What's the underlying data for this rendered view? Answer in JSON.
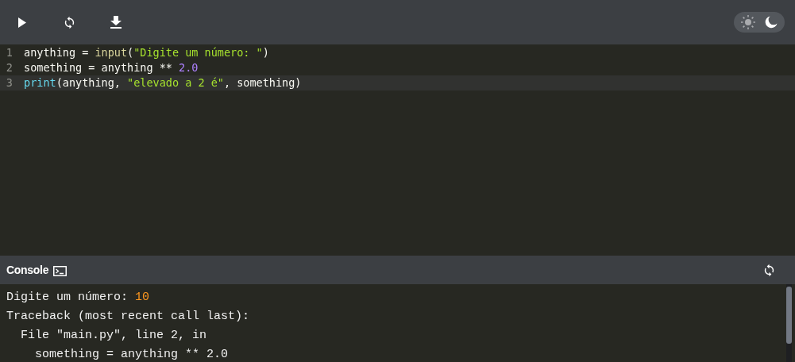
{
  "toolbar": {
    "buttons": [
      {
        "kind": "run"
      },
      {
        "kind": "reset"
      },
      {
        "kind": "download"
      }
    ],
    "theme_toggle": [
      {
        "kind": "light",
        "selected": false
      },
      {
        "kind": "dark",
        "selected": true
      }
    ]
  },
  "editor": {
    "lines": [
      {
        "number": "1",
        "active": false,
        "tokens": [
          {
            "kind": "plain",
            "text": "anything = "
          },
          {
            "kind": "builtin",
            "text": "input"
          },
          {
            "kind": "plain",
            "text": "("
          },
          {
            "kind": "string",
            "text": "\"Digite um número: \""
          },
          {
            "kind": "plain",
            "text": ")"
          }
        ]
      },
      {
        "number": "2",
        "active": false,
        "tokens": [
          {
            "kind": "plain",
            "text": "something = anything ** "
          },
          {
            "kind": "number",
            "text": "2.0"
          }
        ]
      },
      {
        "number": "3",
        "active": true,
        "tokens": [
          {
            "kind": "keyword",
            "text": "print"
          },
          {
            "kind": "plain",
            "text": "(anything, "
          },
          {
            "kind": "string",
            "text": "\"elevado a 2 é\""
          },
          {
            "kind": "plain",
            "text": ", something)"
          }
        ]
      }
    ]
  },
  "console": {
    "title": "Console",
    "lines": [
      [
        {
          "kind": "output",
          "text": "Digite um número: "
        },
        {
          "kind": "input",
          "text": "10"
        }
      ],
      [
        {
          "kind": "output",
          "text": "Traceback (most recent call last):"
        }
      ],
      [
        {
          "kind": "output",
          "text": "  File \"main.py\", line 2, in"
        }
      ],
      [
        {
          "kind": "output",
          "text": "    something = anything ** 2.0"
        }
      ]
    ]
  }
}
